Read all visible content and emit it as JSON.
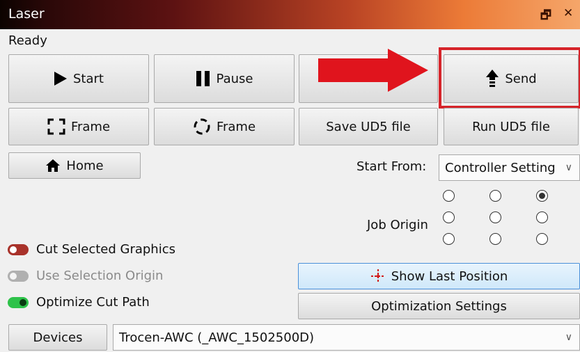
{
  "window": {
    "title": "Laser",
    "restore_glyph": "🗗",
    "close_glyph": "✕"
  },
  "status": "Ready",
  "buttons": {
    "start": "Start",
    "pause": "Pause",
    "send": "Send",
    "frame_rect": "Frame",
    "frame_circle": "Frame",
    "save_ud5": "Save UD5 file",
    "run_ud5": "Run UD5 file",
    "home": "Home",
    "show_last_position": "Show Last Position",
    "optimization_settings": "Optimization Settings",
    "devices": "Devices"
  },
  "start_from": {
    "label": "Start From:",
    "value": "Controller Setting"
  },
  "job_origin": {
    "label": "Job Origin",
    "selected_row": 0,
    "selected_col": 2
  },
  "options": [
    {
      "label": "Cut Selected Graphics",
      "state": "off-red",
      "enabled": true
    },
    {
      "label": "Use Selection Origin",
      "state": "off",
      "enabled": false
    },
    {
      "label": "Optimize Cut Path",
      "state": "on",
      "enabled": true
    }
  ],
  "device_select": {
    "value": "Trocen-AWC (_AWC_1502500D)"
  },
  "colors": {
    "highlight_box": "#d6242a",
    "arrow": "#e0141d",
    "toggle_red": "#a8322a",
    "toggle_green": "#2ec24a",
    "toggle_gray": "#b0b0b0"
  }
}
